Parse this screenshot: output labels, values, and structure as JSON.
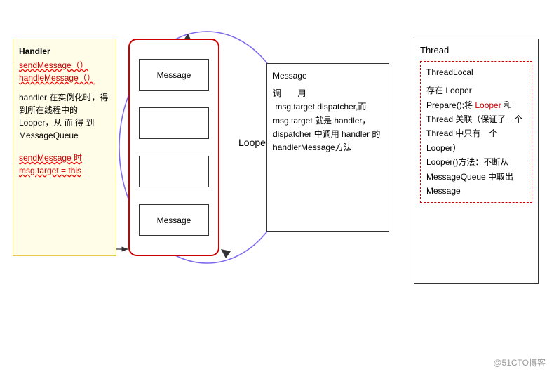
{
  "handler_box": {
    "line1": "Handler",
    "line2": "sendMessage（）",
    "line3": "handleMessage（）",
    "para1": "handler 在实例化时，得到所在线程中的 Looper，从 而 得 到 MessageQueue",
    "para2": "sendMessage 时",
    "para3": "msg.target = this"
  },
  "message_queue_box": {
    "items": [
      "Message",
      "",
      "",
      "Message"
    ]
  },
  "looper_label": "Looper",
  "message_detail": {
    "title": "Message",
    "body": "调 用 msg.target.dispatcher,而 msg.target 就是 handler， dispatcher 中调用 handler 的 handlerMessage方法"
  },
  "thread_box": {
    "title": "Thread",
    "thread_local_title": "ThreadLocal",
    "body": "存在 Looper\nPrepare();将 Looper 和 Thread 关联（保证了一个 Thread 中只有一个 Looper）\nLooper()方法：不断从 MessageQueue 中取出 Message"
  },
  "watermark": "@51CTO博客"
}
